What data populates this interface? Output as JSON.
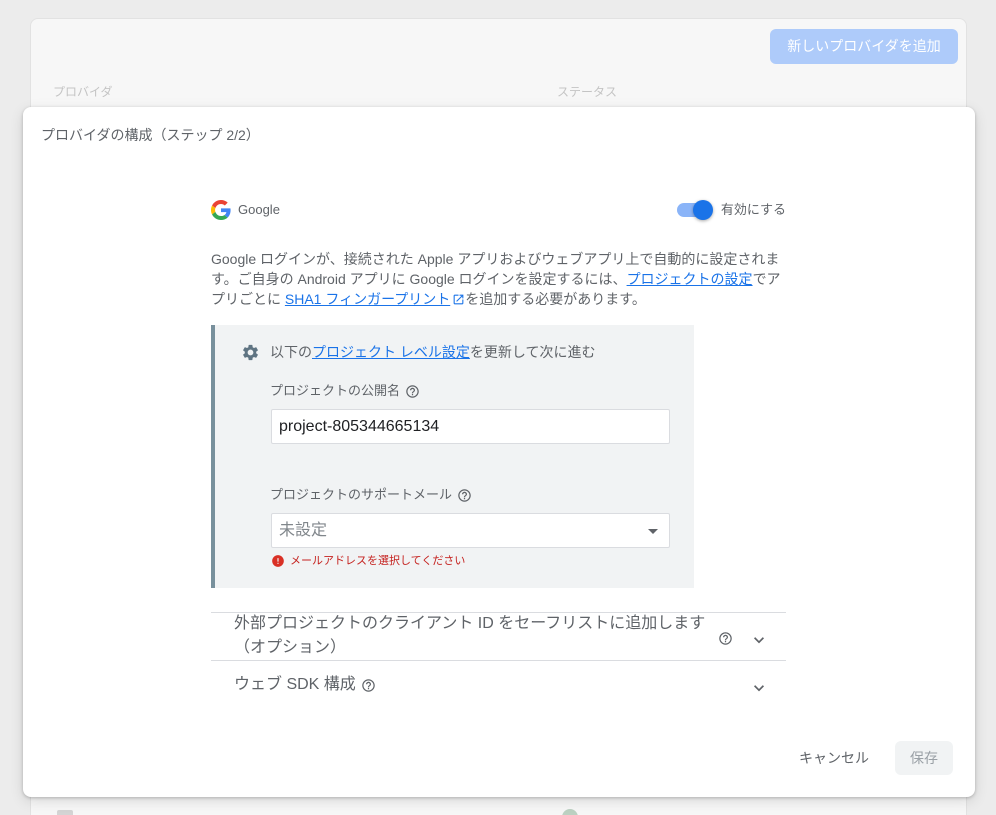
{
  "colors": {
    "primary": "#1a73e8",
    "link": "#1a73e8",
    "error": "#c5221f",
    "toggle_track": "#8ab4f8",
    "add_button": "#aecbfa",
    "panel_accent": "#78909c"
  },
  "background": {
    "add_provider_button": "新しいプロバイダを追加",
    "columns": [
      "プロバイダ",
      "ステータス"
    ]
  },
  "dialog": {
    "title": "プロバイダの構成（ステップ 2/2）",
    "provider": {
      "name": "Google",
      "icon": "google-logo"
    },
    "enable_toggle": {
      "label": "有効にする",
      "on": true
    },
    "description": {
      "text_1": "Google ログインが、接続された Apple アプリおよびウェブアプリ上で自動的に設定されます。ご自身の Android アプリに Google ログインを設定するには、",
      "link_project_settings": "プロジェクトの設定",
      "text_2": "でアプリごとに ",
      "link_sha1": "SHA1 フィンガープリント",
      "link_sha1_icon": "open-in-new-icon",
      "text_3": "を追加する必要があります。"
    },
    "settings_panel": {
      "icon": "gear-icon",
      "heading_before": "以下の",
      "heading_link": "プロジェクト レベル設定",
      "heading_after": "を更新して次に進む",
      "public_name": {
        "label": "プロジェクトの公開名",
        "value": "project-805344665134"
      },
      "support_email": {
        "label": "プロジェクトのサポートメール",
        "placeholder": "未設定",
        "error": "メールアドレスを選択してください"
      }
    },
    "sections": [
      {
        "label": "外部プロジェクトのクライアント ID をセーフリストに追加します（オプション）",
        "expanded": false
      },
      {
        "label": "ウェブ SDK 構成",
        "expanded": false
      }
    ],
    "actions": {
      "cancel": "キャンセル",
      "save": "保存"
    }
  }
}
